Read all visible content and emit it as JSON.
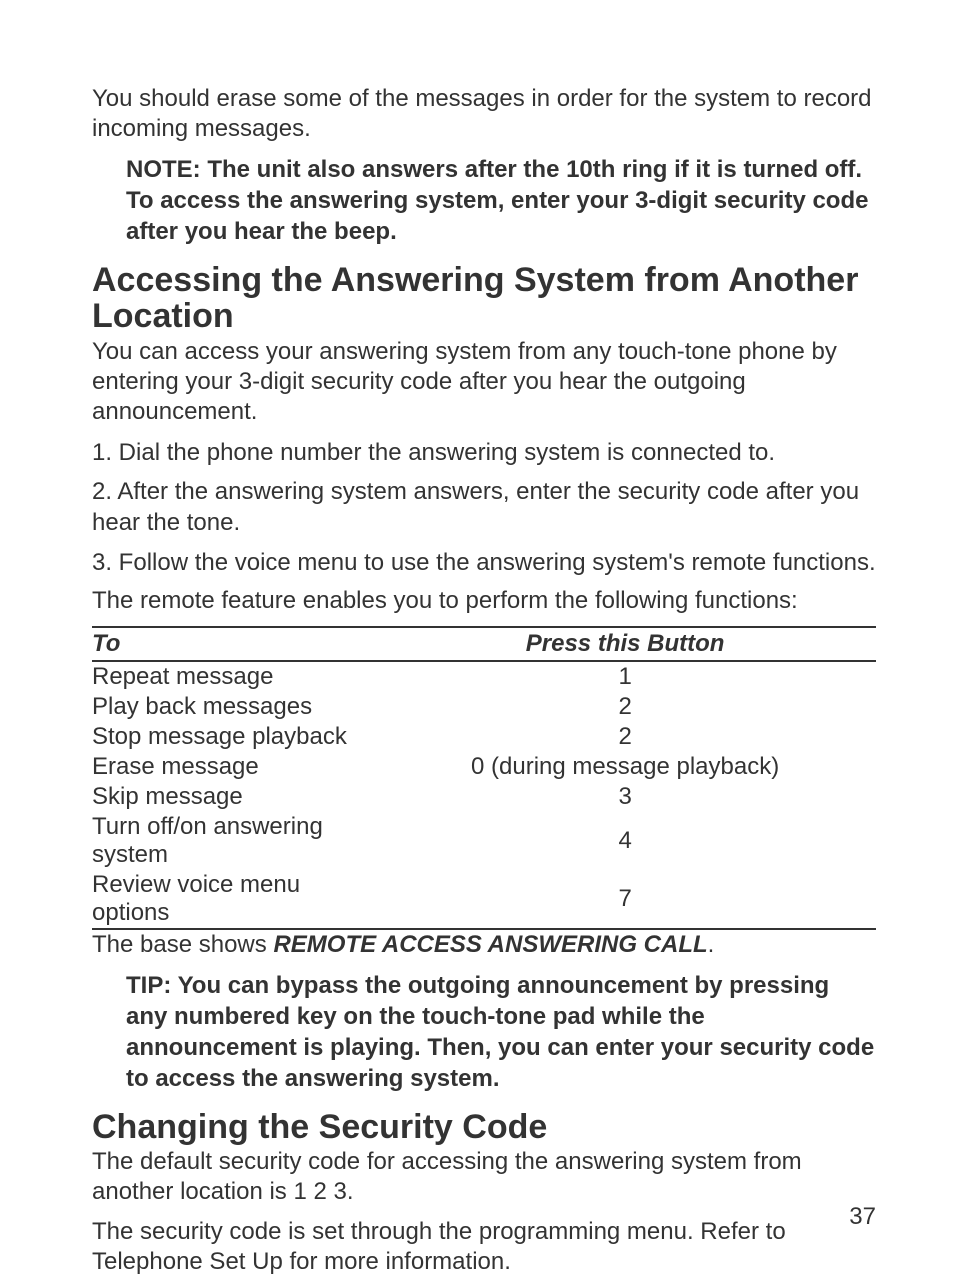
{
  "body": {
    "intro_para": "You should erase some of the messages in order for the system to record incoming messages.",
    "note1": "NOTE: The unit also answers after the 10th ring if it is turned off. To access the answering system, enter your 3-digit security code after you hear the beep.",
    "section1_title": "Accessing the Answering System from Another Location",
    "s1_p1": "You can access your answering system from any touch-tone phone by entering your 3-digit security code after you hear the outgoing announcement.",
    "s1_step1": "1. Dial the phone number the answering system is connected to.",
    "s1_step2": "2. After the answering system answers, enter the security code after you hear the tone.",
    "s1_step3": "3. Follow the voice menu to use the answering system's remote functions.",
    "s1_p2": "The remote feature enables you to perform the following functions:",
    "table": {
      "head_to": "To",
      "head_button": "Press this Button",
      "rows": [
        {
          "to": "Repeat message",
          "btn": "1"
        },
        {
          "to": "Play back messages",
          "btn": "2"
        },
        {
          "to": "Stop message playback",
          "btn": "2"
        },
        {
          "to": "Erase message",
          "btn": "0 (during message playback)"
        },
        {
          "to": "Skip message",
          "btn": "3"
        },
        {
          "to": "Turn off/on answering system",
          "btn": "4"
        },
        {
          "to": "Review voice menu options",
          "btn": "7"
        }
      ]
    },
    "s1_after_table_pre": "The base shows ",
    "s1_after_table_bold": "REMOTE ACCESS ANSWERING CALL",
    "s1_after_table_post": ".",
    "tip": "TIP: You can bypass the outgoing announcement by pressing any numbered key on the touch-tone pad while the announcement is playing. Then, you can enter your security code to access the answering system.",
    "section2_title": "Changing the Security Code",
    "s2_p1": "The default security code for accessing the answering system from another location is 1 2 3.",
    "s2_p2": "The security code is set through the programming menu. Refer to Telephone Set Up for more information."
  },
  "page_number": "37"
}
